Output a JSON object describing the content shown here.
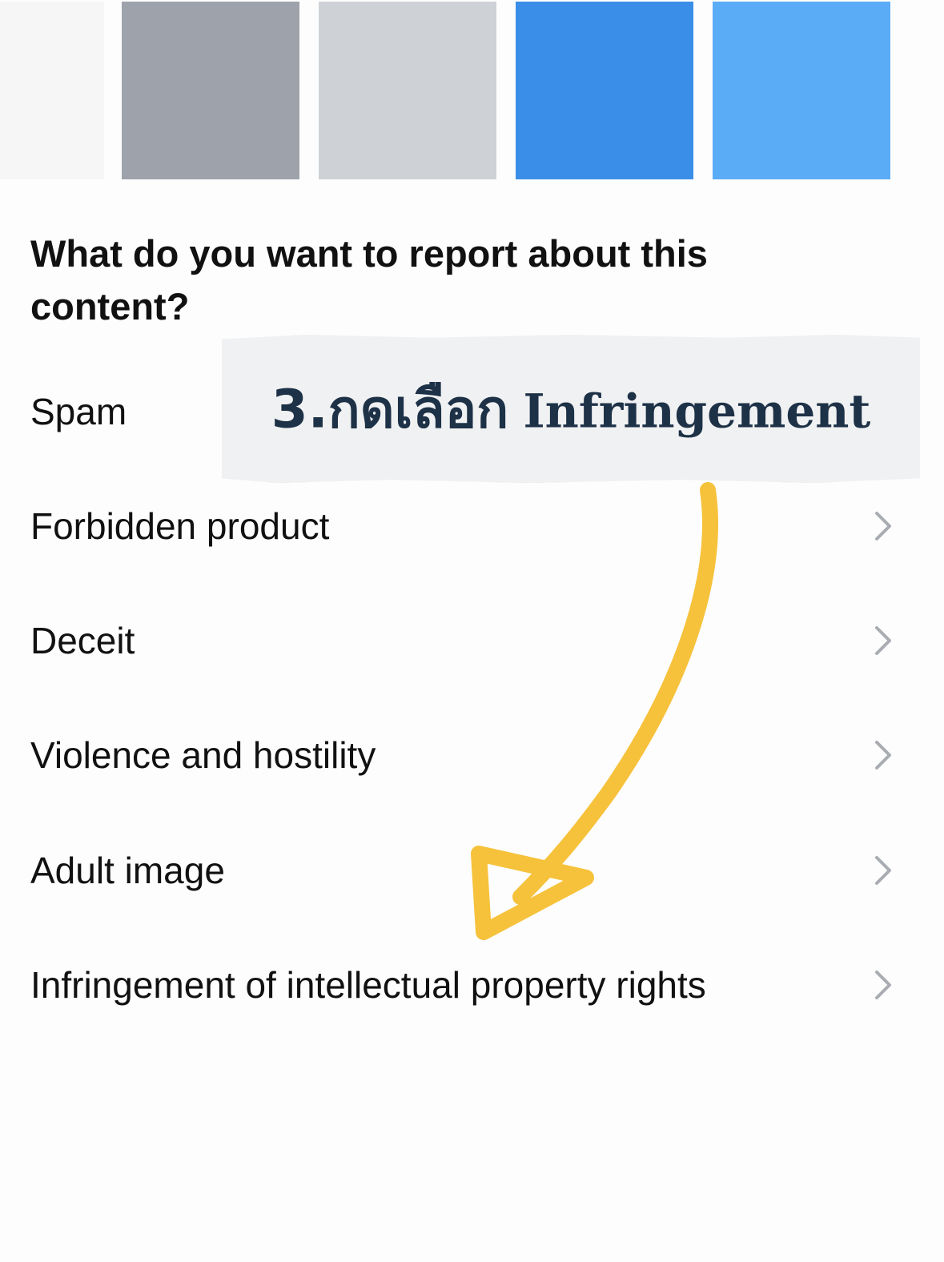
{
  "thumbnails": [
    {
      "color": "#f6f6f7"
    },
    {
      "color": "#9da2ab"
    },
    {
      "color": "#ced2d7"
    },
    {
      "color": "#3a8ee8"
    },
    {
      "color": "#5aacf7"
    }
  ],
  "report": {
    "title": "What do you want to report about this content?",
    "options": [
      {
        "label": "Spam",
        "has_chevron": true
      },
      {
        "label": "Forbidden product",
        "has_chevron": true
      },
      {
        "label": "Deceit",
        "has_chevron": true
      },
      {
        "label": "Violence and hostility",
        "has_chevron": true
      },
      {
        "label": "Adult image",
        "has_chevron": true
      },
      {
        "label": "Infringement of intellectual property rights",
        "has_chevron": true
      }
    ]
  },
  "annotation": {
    "step": "3.",
    "thai_text": "กดเลือก",
    "english_text": "Infringement",
    "arrow_color": "#f6c23b",
    "text_color": "#1d3147"
  },
  "colors": {
    "chevron": "#a9acb1",
    "text": "#111111"
  }
}
